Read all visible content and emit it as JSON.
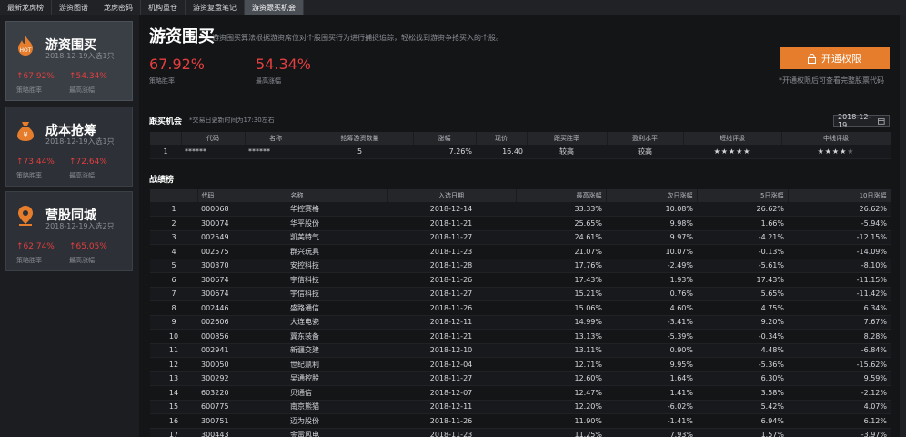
{
  "tabs": [
    "最新龙虎榜",
    "游资图谱",
    "龙虎密码",
    "机构重仓",
    "游资复盘笔记",
    "游资跟买机会"
  ],
  "active_tab": 5,
  "sidebar": {
    "cards": [
      {
        "title": "游资围买",
        "sub": "2018-12-19入选1只",
        "v1": "↑67.92%",
        "l1": "策略胜率",
        "v2": "↑54.34%",
        "l2": "最高涨幅",
        "icon": "hot-icon"
      },
      {
        "title": "成本抢筹",
        "sub": "2018-12-19入选1只",
        "v1": "↑73.44%",
        "l1": "策略胜率",
        "v2": "↑72.64%",
        "l2": "最高涨幅",
        "icon": "money-bag-icon"
      },
      {
        "title": "营股同城",
        "sub": "2018-12-19入选2只",
        "v1": "↑62.74%",
        "l1": "策略胜率",
        "v2": "↑65.05%",
        "l2": "最高涨幅",
        "icon": "location-pin-icon"
      }
    ]
  },
  "header": {
    "title": "游资围买",
    "desc": "游资围买算法根据游资席位对个股围买行为进行捕捉追踪，轻松找到游资争抢买入的个股。",
    "stat1_value": "67.92%",
    "stat1_label": "策略胜率",
    "stat2_value": "54.34%",
    "stat2_label": "最高涨幅",
    "open_label": "开通权限",
    "open_note": "*开通权限后可查看完整股票代码"
  },
  "follow": {
    "title": "跟买机会",
    "note": "*交易日更新时间为17:30左右",
    "date": "2018-12-19",
    "headers": [
      "",
      "代码",
      "名称",
      "抢筹游资数量",
      "涨幅",
      "现价",
      "跟买胜率",
      "盈利水平",
      "短线评级",
      "中线评级"
    ],
    "row": {
      "idx": "1",
      "code": "******",
      "name": "******",
      "count": "5",
      "change": "7.26%",
      "price": "16.40",
      "win": "较高",
      "profit": "较高",
      "short": 5,
      "mid": 4
    }
  },
  "record": {
    "title": "战绩榜",
    "headers": [
      "",
      "代码",
      "名称",
      "入选日期",
      "最高涨幅",
      "次日涨幅",
      "5日涨幅",
      "10日涨幅"
    ],
    "rows": [
      [
        "1",
        "000068",
        "华控赛格",
        "2018-12-14",
        "33.33%",
        "10.08%",
        "26.62%",
        "26.62%"
      ],
      [
        "2",
        "300074",
        "华平股份",
        "2018-11-21",
        "25.65%",
        "9.98%",
        "1.66%",
        "-5.94%"
      ],
      [
        "3",
        "002549",
        "凯美特气",
        "2018-11-27",
        "24.61%",
        "9.97%",
        "-4.21%",
        "-12.15%"
      ],
      [
        "4",
        "002575",
        "群兴玩具",
        "2018-11-23",
        "21.07%",
        "10.07%",
        "-0.13%",
        "-14.09%"
      ],
      [
        "5",
        "300370",
        "安控科技",
        "2018-11-28",
        "17.76%",
        "-2.49%",
        "-5.61%",
        "-8.10%"
      ],
      [
        "6",
        "300674",
        "宇信科技",
        "2018-11-26",
        "17.43%",
        "1.93%",
        "17.43%",
        "-11.15%"
      ],
      [
        "7",
        "300674",
        "宇信科技",
        "2018-11-27",
        "15.21%",
        "0.76%",
        "5.65%",
        "-11.42%"
      ],
      [
        "8",
        "002446",
        "盛路通信",
        "2018-11-26",
        "15.06%",
        "4.60%",
        "4.75%",
        "6.34%"
      ],
      [
        "9",
        "002606",
        "大连电瓷",
        "2018-12-11",
        "14.99%",
        "-3.41%",
        "9.20%",
        "7.67%"
      ],
      [
        "10",
        "000856",
        "冀东装备",
        "2018-11-21",
        "13.13%",
        "-5.39%",
        "-0.34%",
        "8.28%"
      ],
      [
        "11",
        "002941",
        "新疆交建",
        "2018-12-10",
        "13.11%",
        "0.90%",
        "4.48%",
        "-6.84%"
      ],
      [
        "12",
        "300050",
        "世纪鼎利",
        "2018-12-04",
        "12.71%",
        "9.95%",
        "-5.36%",
        "-15.62%"
      ],
      [
        "13",
        "300292",
        "吴通控股",
        "2018-11-27",
        "12.60%",
        "1.64%",
        "6.30%",
        "9.59%"
      ],
      [
        "14",
        "603220",
        "贝通信",
        "2018-12-07",
        "12.47%",
        "1.41%",
        "3.58%",
        "-2.12%"
      ],
      [
        "15",
        "600775",
        "南京熊猫",
        "2018-12-11",
        "12.20%",
        "-6.02%",
        "5.42%",
        "4.07%"
      ],
      [
        "16",
        "300751",
        "迈为股份",
        "2018-11-26",
        "11.90%",
        "-1.41%",
        "6.94%",
        "6.12%"
      ],
      [
        "17",
        "300443",
        "金雷风电",
        "2018-11-23",
        "11.25%",
        "7.93%",
        "1.57%",
        "-3.97%"
      ]
    ]
  }
}
